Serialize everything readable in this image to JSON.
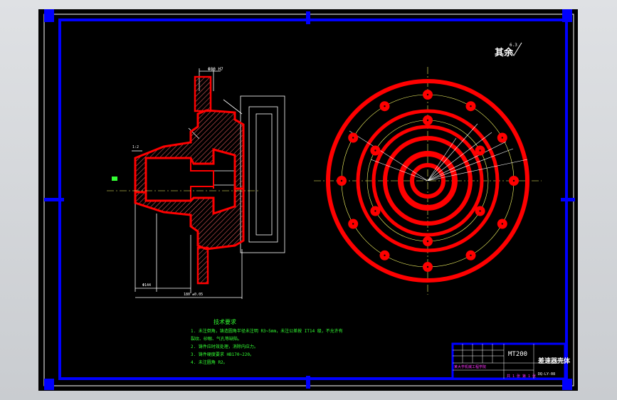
{
  "drawing": {
    "surface_roughness_note": "其余",
    "roughness_value": "6.3",
    "title_block": {
      "material": "MT200",
      "part_name": "差速器壳体",
      "drawing_number": "DQ-LY-08",
      "company_line": "某大学机械工程学院",
      "sheet_line": "共 1 张 第 1 张"
    },
    "tech_requirements": {
      "title": "技术要求",
      "items": [
        "1. 未注倒角，铸造圆角半径未注明 R3~5mm，未注公差按 IT14 级，不允许有",
        "裂纹、砂眼、气孔等缺陷。",
        "2. 铸件应时效处理，消除内应力。",
        "3. 铸件硬度要求 HB170~220。",
        "4. 未注圆角 R2。"
      ]
    },
    "dimensions": {
      "top_label": "Φ80 H7",
      "bottom_labels": [
        "Φ144",
        "180 ±0.05"
      ],
      "side_label": "1:2"
    }
  },
  "colors": {
    "border": "#0000ff",
    "part": "#ff0000",
    "dimension": "#ffffff",
    "centerline": "#ffff66",
    "text_green": "#33ff33",
    "text_magenta": "#ff33ff",
    "background": "#000000"
  }
}
